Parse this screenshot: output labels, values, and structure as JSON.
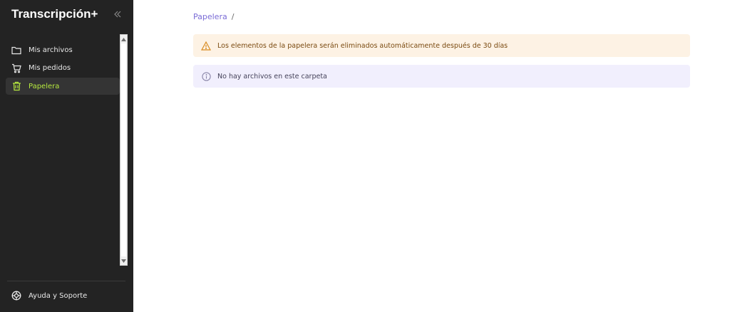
{
  "app": {
    "title": "Transcripción+"
  },
  "sidebar": {
    "collapse_icon": "double-chevron-left-icon",
    "items": [
      {
        "label": "Mis archivos",
        "icon": "folder-icon",
        "active": false
      },
      {
        "label": "Mis pedidos",
        "icon": "cart-icon",
        "active": false
      },
      {
        "label": "Papelera",
        "icon": "trash-icon",
        "active": true
      }
    ],
    "help": {
      "label": "Ayuda y Soporte",
      "icon": "lifebuoy-icon"
    }
  },
  "breadcrumb": {
    "current": "Papelera",
    "separator": "/"
  },
  "alerts": {
    "warning": {
      "text": "Los elementos de la papelera serán eliminados automáticamente después de 30 días",
      "icon": "warning-triangle-icon"
    },
    "info": {
      "text": "No hay archivos en este carpeta",
      "icon": "info-circle-icon"
    }
  },
  "colors": {
    "sidebar_bg": "#232323",
    "accent_green": "#b7ea3f",
    "link_purple": "#7a6bd6",
    "warning_bg": "#fdf2e4",
    "info_bg": "#f1effd"
  }
}
